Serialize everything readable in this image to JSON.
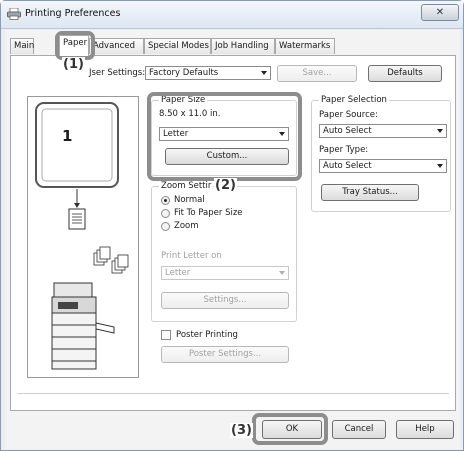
{
  "window": {
    "title": "Printing Preferences",
    "close_label": "✕"
  },
  "tabs": [
    "Main",
    "Paper",
    "Advanced",
    "Special Modes",
    "Job Handling",
    "Watermarks"
  ],
  "user_settings": {
    "label": "User Settings:",
    "label_visible": "Jser Settings:",
    "value": "Factory Defaults",
    "save_label": "Save...",
    "defaults_label": "Defaults"
  },
  "preview": {
    "page_number": "1"
  },
  "paper_size": {
    "title": "Paper Size",
    "dimensions": "8.50 x 11.0 in.",
    "value": "Letter",
    "custom_label": "Custom..."
  },
  "zoom": {
    "title": "Zoom Settir",
    "options": [
      "Normal",
      "Fit To Paper Size",
      "Zoom"
    ],
    "selected": "Normal",
    "print_on_label": "Print Letter on",
    "print_on_value": "Letter",
    "settings_label": "Settings..."
  },
  "poster": {
    "label": "Poster Printing",
    "settings_label": "Poster Settings..."
  },
  "paper_selection": {
    "title": "Paper Selection",
    "source_label": "Paper Source:",
    "source_value": "Auto Select",
    "type_label": "Paper Type:",
    "type_value": "Auto Select",
    "tray_status_label": "Tray Status..."
  },
  "buttons": {
    "ok": "OK",
    "cancel": "Cancel",
    "help": "Help"
  },
  "callouts": {
    "c1": "(1)",
    "c2": "(2)",
    "c3": "(3)"
  },
  "colors": {
    "highlight": "#8d8d8d",
    "title_bar": "#dde6f1"
  }
}
